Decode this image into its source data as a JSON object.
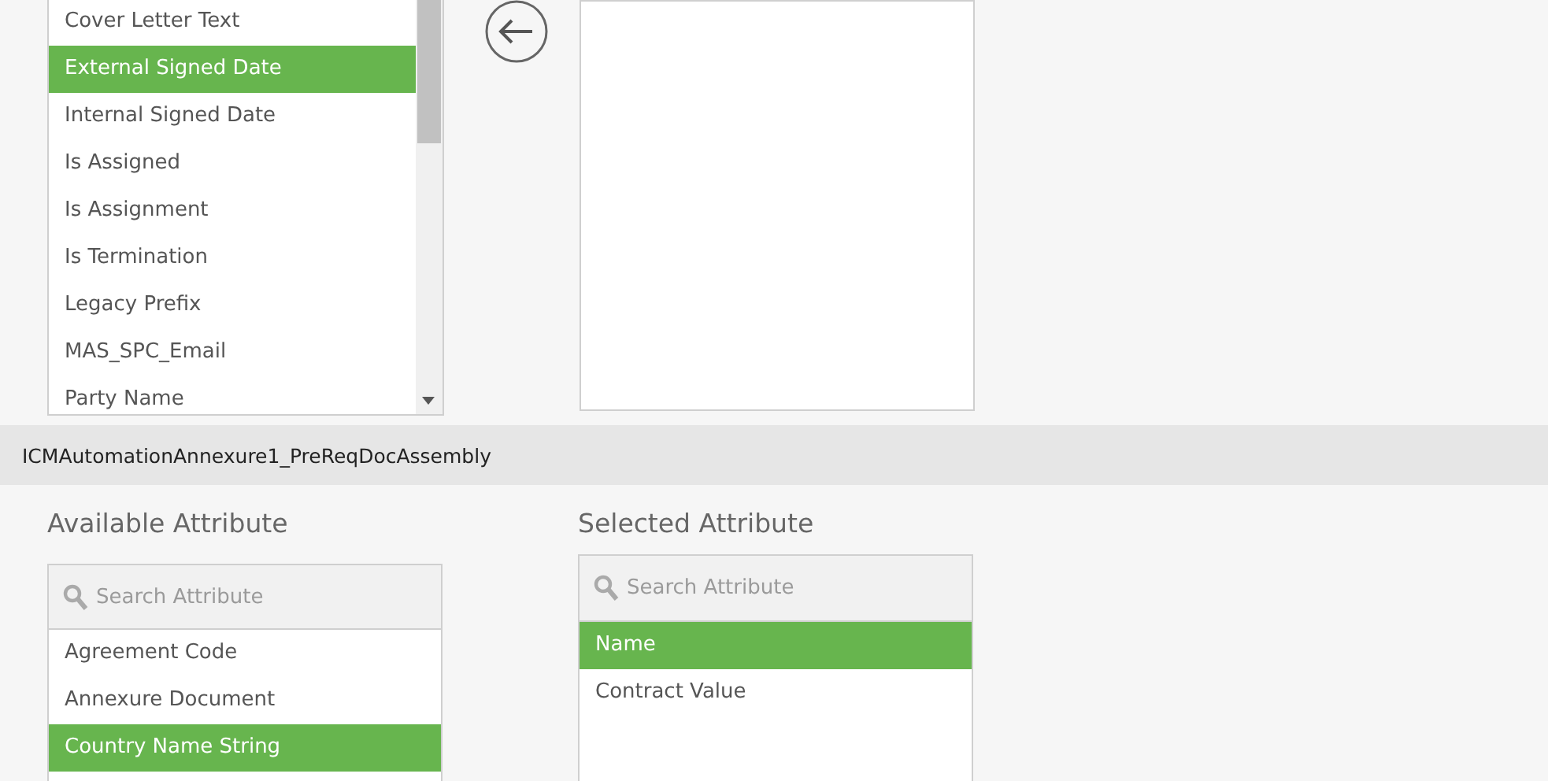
{
  "top": {
    "available_items": [
      {
        "label": "Cover Letter Text",
        "selected": false
      },
      {
        "label": "External Signed Date",
        "selected": true
      },
      {
        "label": "Internal Signed Date",
        "selected": false
      },
      {
        "label": "Is Assigned",
        "selected": false
      },
      {
        "label": "Is Assignment",
        "selected": false
      },
      {
        "label": "Is Termination",
        "selected": false
      },
      {
        "label": "Legacy Prefix",
        "selected": false
      },
      {
        "label": "MAS_SPC_Email",
        "selected": false
      },
      {
        "label": "Party Name",
        "selected": false
      }
    ]
  },
  "section_title": "ICMAutomationAnnexure1_PreReqDocAssembly",
  "available": {
    "heading": "Available Attribute",
    "search": {
      "placeholder": "Search Attribute"
    },
    "items": [
      {
        "label": "Agreement Code",
        "selected": false
      },
      {
        "label": "Annexure Document",
        "selected": false
      },
      {
        "label": "Country Name String",
        "selected": true
      }
    ]
  },
  "selected": {
    "heading": "Selected Attribute",
    "search": {
      "placeholder": "Search Attribute"
    },
    "items": [
      {
        "label": "Name",
        "selected": true
      },
      {
        "label": "Contract Value",
        "selected": false
      }
    ]
  }
}
